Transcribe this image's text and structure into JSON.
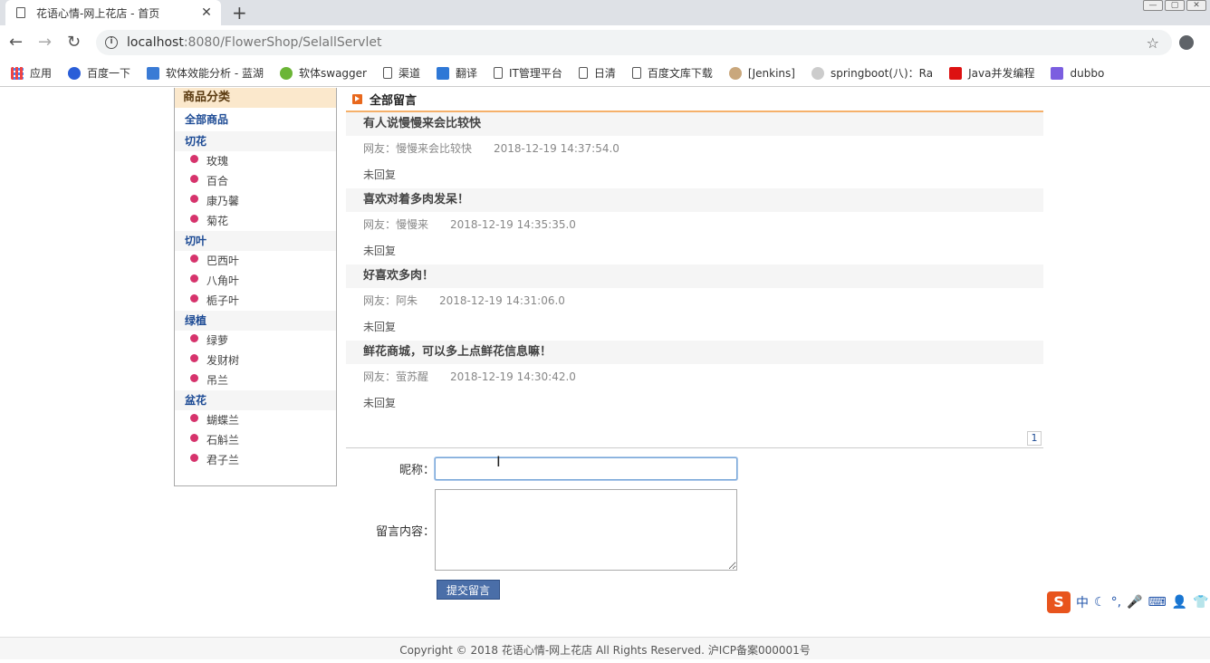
{
  "browser": {
    "tab_title": "花语心情-网上花店 - 首页",
    "tab_close": "✕",
    "new_tab": "+",
    "url_host": "localhost",
    "url_rest": ":8080/FlowerShop/SelallServlet",
    "bookmarks": [
      {
        "label": "应用",
        "icon": "apps-icon"
      },
      {
        "label": "百度一下",
        "icon": "baidu-icon"
      },
      {
        "label": "软体效能分析 - 蓝湖",
        "icon": "lanhu-icon"
      },
      {
        "label": "软体swagger",
        "icon": "swagger-icon"
      },
      {
        "label": "渠道",
        "icon": "page-icon"
      },
      {
        "label": "翻译",
        "icon": "translate-icon"
      },
      {
        "label": "IT管理平台",
        "icon": "page-icon"
      },
      {
        "label": "日清",
        "icon": "page-icon"
      },
      {
        "label": "百度文库下载",
        "icon": "page-icon"
      },
      {
        "label": "[Jenkins]",
        "icon": "jenkins-icon"
      },
      {
        "label": "springboot(八)：Ra",
        "icon": "springboot-icon"
      },
      {
        "label": "Java并发编程",
        "icon": "csdn-icon"
      },
      {
        "label": "dubbo",
        "icon": "dubbo-icon"
      }
    ]
  },
  "sidebar": {
    "title": "商品分类",
    "all": "全部商品",
    "categories": [
      {
        "name": "切花",
        "items": [
          "玫瑰",
          "百合",
          "康乃馨",
          "菊花"
        ]
      },
      {
        "name": "切叶",
        "items": [
          "巴西叶",
          "八角叶",
          "栀子叶"
        ]
      },
      {
        "name": "绿植",
        "items": [
          "绿萝",
          "发财树",
          "吊兰"
        ]
      },
      {
        "name": "盆花",
        "items": [
          "蝴蝶兰",
          "石斛兰",
          "君子兰"
        ]
      }
    ]
  },
  "main": {
    "title": "全部留言",
    "messages": [
      {
        "subject": "有人说慢慢来会比较快",
        "author": "网友：慢慢来会比较快",
        "time": "2018-12-19 14:37:54.0",
        "reply": "未回复"
      },
      {
        "subject": "喜欢对着多肉发呆！",
        "author": "网友：慢慢来",
        "time": "2018-12-19 14:35:35.0",
        "reply": "未回复"
      },
      {
        "subject": "好喜欢多肉！",
        "author": "网友：阿朱",
        "time": "2018-12-19 14:31:06.0",
        "reply": "未回复"
      },
      {
        "subject": "鲜花商城，可以多上点鲜花信息嘛！",
        "author": "网友：萤苏醒",
        "time": "2018-12-19 14:30:42.0",
        "reply": "未回复"
      }
    ],
    "page": "1"
  },
  "form": {
    "nickname_label": "昵称：",
    "nickname_value": "",
    "content_label": "留言内容：",
    "content_value": "",
    "submit_label": "提交留言"
  },
  "footer": {
    "text": "Copyright © 2018 花语心情-网上花店 All Rights Reserved. 沪ICP备案000001号"
  },
  "ime": {
    "logo": "S",
    "lang": "中"
  }
}
